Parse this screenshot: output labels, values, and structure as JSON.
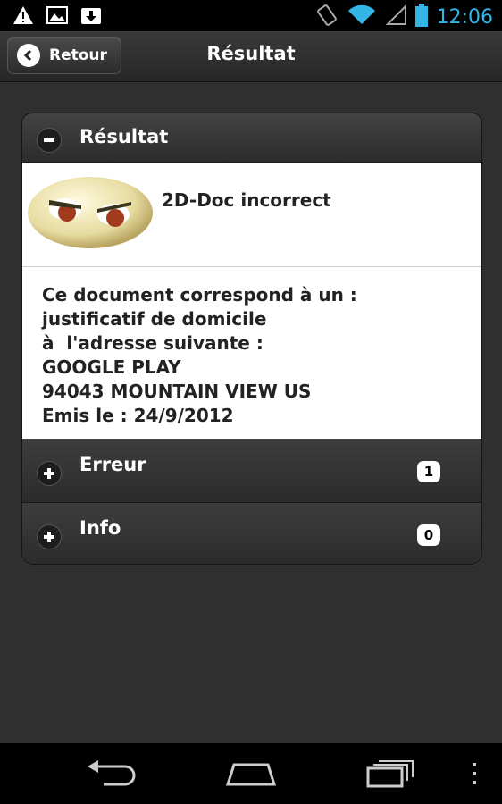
{
  "status_bar": {
    "time": "12:06",
    "left_icons": [
      "warning-icon",
      "image-icon",
      "download-icon"
    ],
    "right_icons": [
      "rotation-icon",
      "wifi-icon",
      "signal-icon",
      "battery-icon"
    ],
    "accent_color": "#33b5e5"
  },
  "header": {
    "back_label": "Retour",
    "title": "Résultat"
  },
  "result_section": {
    "title": "Résultat",
    "expanded": true,
    "status_text": "2D-Doc incorrect",
    "body_lines": [
      "Ce document correspond à un :",
      "justificatif de domicile",
      "à  l'adresse suivante :",
      "GOOGLE PLAY",
      "94043 MOUNTAIN VIEW US",
      "Emis le : 24/9/2012"
    ]
  },
  "collapsibles": [
    {
      "title": "Erreur",
      "count": "1"
    },
    {
      "title": "Info",
      "count": "0"
    }
  ],
  "nav_bar": {
    "icons": [
      "back-icon",
      "home-icon",
      "recent-apps-icon",
      "overflow-menu-icon"
    ]
  }
}
